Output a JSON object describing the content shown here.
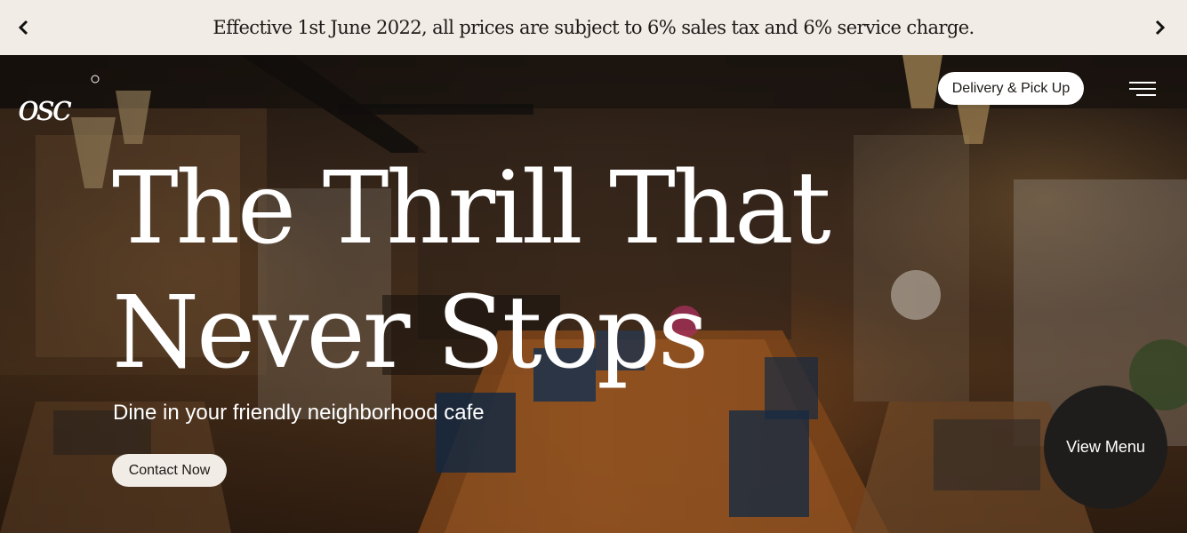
{
  "announcement": {
    "text": "Effective 1st June 2022, all prices are subject to 6% sales tax and 6% service charge.",
    "prev_icon": "chevron-left-icon",
    "next_icon": "chevron-right-icon"
  },
  "header": {
    "logo_text": "OSC",
    "delivery_label": "Delivery & Pick Up",
    "menu_icon": "hamburger-menu-icon"
  },
  "hero": {
    "title": "The Thrill That Never Stops",
    "subtitle": "Dine in your friendly neighborhood cafe",
    "cta_label": "Contact Now",
    "view_menu_label": "View Menu"
  },
  "colors": {
    "announcement_bg": "#f1ece6",
    "button_bg": "#ffffff",
    "view_menu_bg": "#1f1d1c",
    "text_dark": "#1d1a17"
  }
}
